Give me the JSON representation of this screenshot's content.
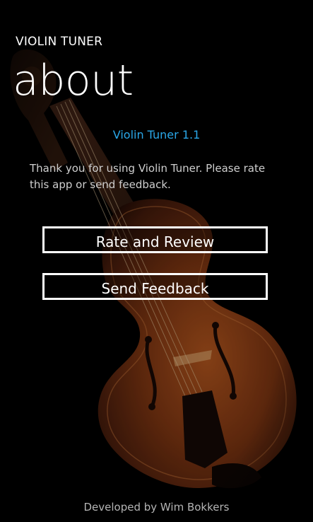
{
  "header": {
    "app_title": "VIOLIN TUNER",
    "page_title": "about"
  },
  "main": {
    "version": "Violin Tuner 1.1",
    "description": "Thank you for using Violin Tuner. Please rate this app or send feedback.",
    "buttons": {
      "rate_label": "Rate and Review",
      "feedback_label": "Send Feedback"
    }
  },
  "footer": {
    "credit": "Developed by Wim Bokkers"
  },
  "colors": {
    "background": "#000000",
    "accent": "#2aa7e8",
    "violin_wood": "#7a3a14"
  },
  "background_image": "violin-image"
}
